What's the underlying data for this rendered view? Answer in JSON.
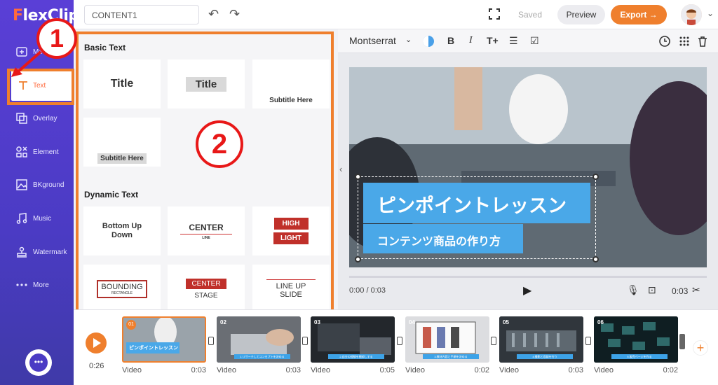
{
  "app": {
    "logo": "FlexClip",
    "project_name": "CONTENT1"
  },
  "sidebar": {
    "items": [
      {
        "label": "Media",
        "icon": "media-icon"
      },
      {
        "label": "Text",
        "icon": "text-icon"
      },
      {
        "label": "Overlay",
        "icon": "overlay-icon"
      },
      {
        "label": "Element",
        "icon": "element-icon"
      },
      {
        "label": "BKground",
        "icon": "background-icon"
      },
      {
        "label": "Music",
        "icon": "music-icon"
      },
      {
        "label": "Watermark",
        "icon": "watermark-icon"
      },
      {
        "label": "More",
        "icon": "more-icon"
      }
    ]
  },
  "topbar": {
    "saved": "Saved",
    "preview": "Preview",
    "export": "Export →"
  },
  "panel": {
    "basic_title": "Basic Text",
    "basic": [
      "Title",
      "Title",
      "Subtitle Here",
      "Subtitle Here"
    ],
    "dynamic_title": "Dynamic Text",
    "dynamic": {
      "bottom_up": "Bottom Up\nDown",
      "center": "CENTER",
      "center_sub": "LINE",
      "high": "HIGH",
      "light": "LIGHT",
      "bounding": "BOUNDING",
      "bounding_sub": "RECTANGLE",
      "center_stage": "CENTER",
      "center_stage_sub": "STAGE",
      "lineup": "LINE UP",
      "lineup_sub": "SLIDE"
    }
  },
  "format": {
    "font": "Montserrat",
    "bold": "B",
    "italic": "I",
    "size": "T+"
  },
  "preview": {
    "title_text": "ピンポイントレッスン",
    "subtitle_text": "コンテンツ商品の作り方"
  },
  "controls": {
    "time": "0:00 / 0:03",
    "duration": "0:03"
  },
  "timeline": {
    "total": "0:26",
    "clips": [
      {
        "num": "01",
        "label": "Video",
        "dur": "0:03",
        "caption": "ピンポイントレッスン"
      },
      {
        "num": "02",
        "label": "Video",
        "dur": "0:03",
        "caption": "1.リサーチしてコンセプトを決める"
      },
      {
        "num": "03",
        "label": "Video",
        "dur": "0:05",
        "caption": "2.自分の経験を棚卸しする"
      },
      {
        "num": "04",
        "label": "Video",
        "dur": "0:02",
        "caption": "3.教材内容と手順を決める"
      },
      {
        "num": "05",
        "label": "Video",
        "dur": "0:03",
        "caption": "4.撮影と収録を行う"
      },
      {
        "num": "06",
        "label": "Video",
        "dur": "0:02",
        "caption": "5.販売ページを作る"
      }
    ]
  },
  "annotations": {
    "one": "1",
    "two": "2"
  },
  "colors": {
    "accent": "#ef7f2d",
    "sidebar": "#4b3bc4",
    "annot_red": "#e81818",
    "caption_blue": "#3da3e8"
  }
}
